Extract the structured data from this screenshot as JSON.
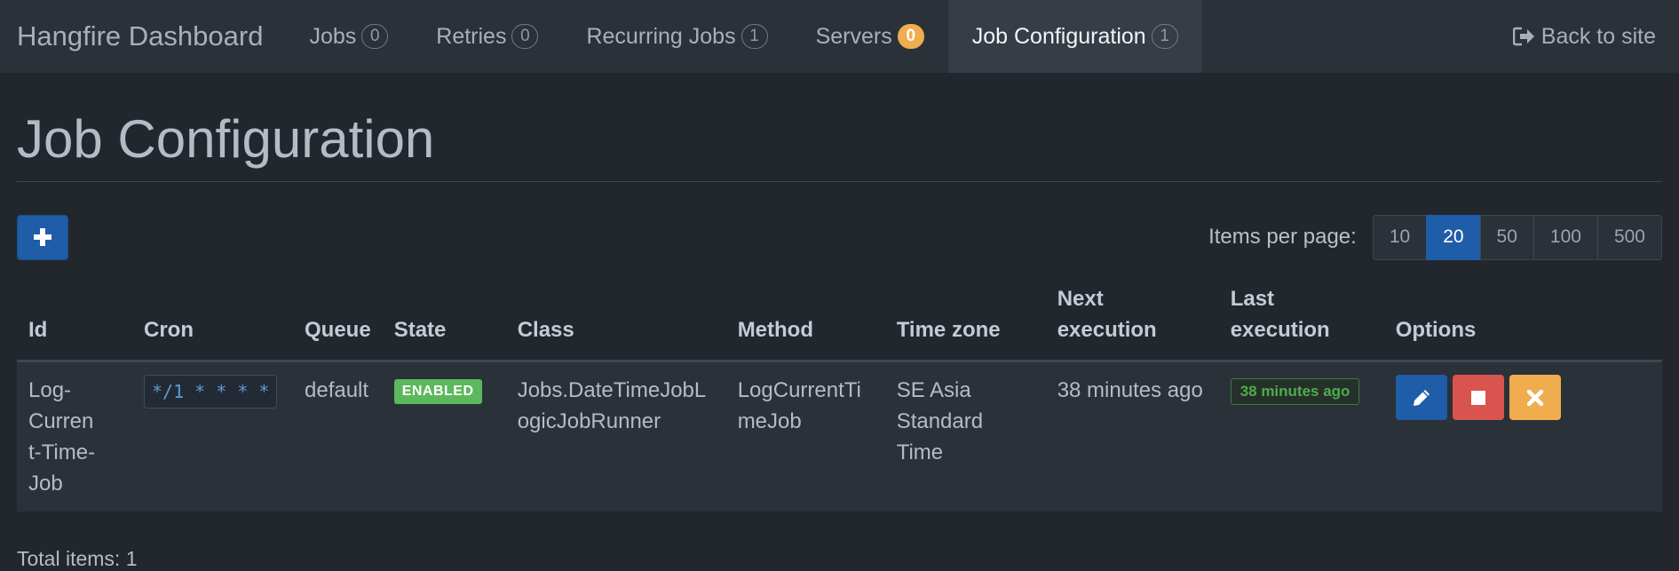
{
  "navbar": {
    "brand": "Hangfire Dashboard",
    "items": [
      {
        "label": "Jobs",
        "count": "0"
      },
      {
        "label": "Retries",
        "count": "0"
      },
      {
        "label": "Recurring Jobs",
        "count": "1"
      },
      {
        "label": "Servers",
        "count": "0"
      },
      {
        "label": "Job Configuration",
        "count": "1"
      }
    ],
    "back_label": "Back to site",
    "back_icon": "sign-out-icon"
  },
  "page": {
    "title": "Job Configuration",
    "add_icon": "plus-icon"
  },
  "pager": {
    "label": "Items per page:",
    "options": [
      "10",
      "20",
      "50",
      "100",
      "500"
    ],
    "selected": "20"
  },
  "table": {
    "headers": {
      "id": "Id",
      "cron": "Cron",
      "queue": "Queue",
      "state": "State",
      "class": "Class",
      "method": "Method",
      "timezone": "Time zone",
      "next_line1": "Next",
      "next_line2": "execution",
      "last_line1": "Last",
      "last_line2": "execution",
      "options": "Options"
    },
    "rows": [
      {
        "id_line1": "Log-Curren",
        "id_line2": "t-Time-Job",
        "cron": "*/1 * * * *",
        "queue": "default",
        "state": "ENABLED",
        "class_line1": "Jobs.DateTimeJobL",
        "class_line2": "ogicJobRunner",
        "method_line1": "LogCurrentTi",
        "method_line2": "meJob",
        "timezone_line1": "SE Asia",
        "timezone_line2": "Standard Time",
        "next_execution": "38 minutes ago",
        "last_execution": "38 minutes ago"
      }
    ]
  },
  "footer": {
    "total": "Total items: 1"
  },
  "colors": {
    "primary": "#1f5da8",
    "success": "#5cb85c",
    "danger": "#d9534f",
    "warning": "#f0ad4e",
    "background": "#22272e"
  }
}
